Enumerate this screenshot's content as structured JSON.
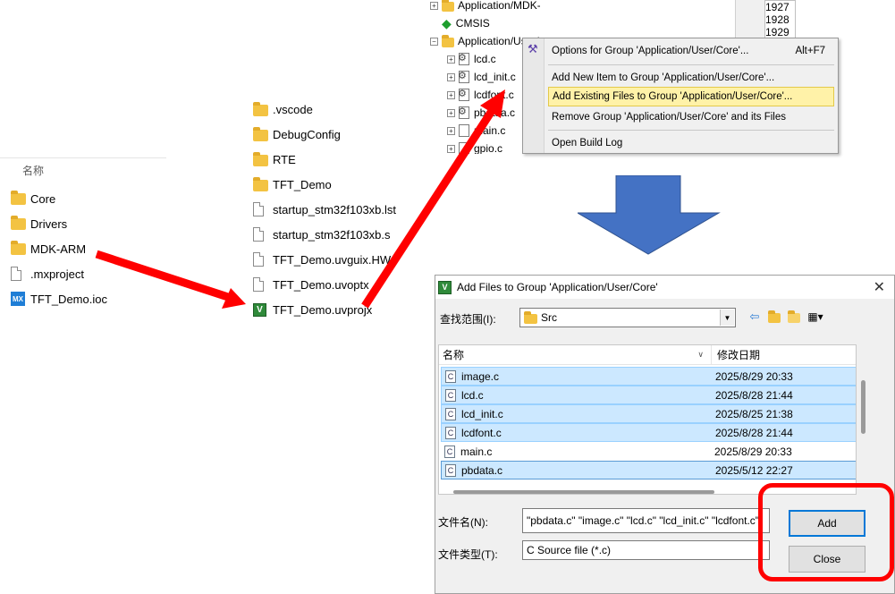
{
  "explorer_left": {
    "column_header": "名称",
    "items": [
      {
        "label": "Core",
        "icon": "folder-icon"
      },
      {
        "label": "Drivers",
        "icon": "folder-icon"
      },
      {
        "label": "MDK-ARM",
        "icon": "folder-icon"
      },
      {
        "label": ".mxproject",
        "icon": "file-icon"
      },
      {
        "label": "TFT_Demo.ioc",
        "icon": "cubemx-icon",
        "icon_text": "MX"
      }
    ]
  },
  "explorer_middle": {
    "items": [
      {
        "label": ".vscode",
        "icon": "folder-icon"
      },
      {
        "label": "DebugConfig",
        "icon": "folder-icon"
      },
      {
        "label": "RTE",
        "icon": "folder-icon"
      },
      {
        "label": "TFT_Demo",
        "icon": "folder-icon"
      },
      {
        "label": "startup_stm32f103xb.lst",
        "icon": "file-icon"
      },
      {
        "label": "startup_stm32f103xb.s",
        "icon": "file-icon"
      },
      {
        "label": "TFT_Demo.uvguix.HW",
        "icon": "file-icon"
      },
      {
        "label": "TFT_Demo.uvoptx",
        "icon": "file-icon"
      },
      {
        "label": "TFT_Demo.uvprojx",
        "icon": "keil-project-icon",
        "icon_text": "V"
      }
    ]
  },
  "project_tree": {
    "rows": [
      {
        "label": "Application/MDK-ARM",
        "expander": "+"
      },
      {
        "label": "CMSIS",
        "expander": ""
      },
      {
        "label": "Application/User/Core",
        "expander": "−"
      },
      {
        "label": "lcd.c",
        "expander": "+"
      },
      {
        "label": "lcd_init.c",
        "expander": "+"
      },
      {
        "label": "lcdfont.c",
        "expander": "+"
      },
      {
        "label": "pbdata.c",
        "expander": "+"
      },
      {
        "label": "main.c",
        "expander": "+"
      },
      {
        "label": "gpio.c",
        "expander": "+"
      }
    ],
    "line_numbers": [
      "1927",
      "1928",
      "1929"
    ]
  },
  "context_menu": {
    "items": [
      {
        "label": "Options for Group 'Application/User/Core'...",
        "shortcut": "Alt+F7"
      },
      {
        "label": "Add New  Item to Group 'Application/User/Core'...",
        "shortcut": ""
      },
      {
        "label": "Add Existing Files to Group 'Application/User/Core'...",
        "shortcut": ""
      },
      {
        "label": "Remove Group 'Application/User/Core' and its Files",
        "shortcut": ""
      },
      {
        "label": "Open Build Log",
        "shortcut": ""
      }
    ],
    "highlighted_index": 2
  },
  "dialog": {
    "title": "Add Files to Group 'Application/User/Core'",
    "close_glyph": "✕",
    "look_in_label": "查找范围(I):",
    "look_in_value": "Src",
    "columns": {
      "name": "名称",
      "modified": "修改日期"
    },
    "files": [
      {
        "name": "image.c",
        "date": "2025/8/29 20:33",
        "selected": true
      },
      {
        "name": "lcd.c",
        "date": "2025/8/28 21:44",
        "selected": true
      },
      {
        "name": "lcd_init.c",
        "date": "2025/8/25 21:38",
        "selected": true
      },
      {
        "name": "lcdfont.c",
        "date": "2025/8/28 21:44",
        "selected": true
      },
      {
        "name": "main.c",
        "date": "2025/8/29 20:33",
        "selected": false
      },
      {
        "name": "pbdata.c",
        "date": "2025/5/12 22:27",
        "selected": true
      }
    ],
    "file_name_label": "文件名(N):",
    "file_name_value": "\"pbdata.c\" \"image.c\" \"lcd.c\" \"lcd_init.c\" \"lcdfont.c\"",
    "file_type_label": "文件类型(T):",
    "file_type_value": "C Source file (*.c)",
    "add_label": "Add",
    "close_label": "Close"
  },
  "colors": {
    "annotation_red": "#ff0000",
    "blue_arrow": "#4472c4",
    "selection": "#cce8ff",
    "menu_highlight": "#fff2a8"
  }
}
